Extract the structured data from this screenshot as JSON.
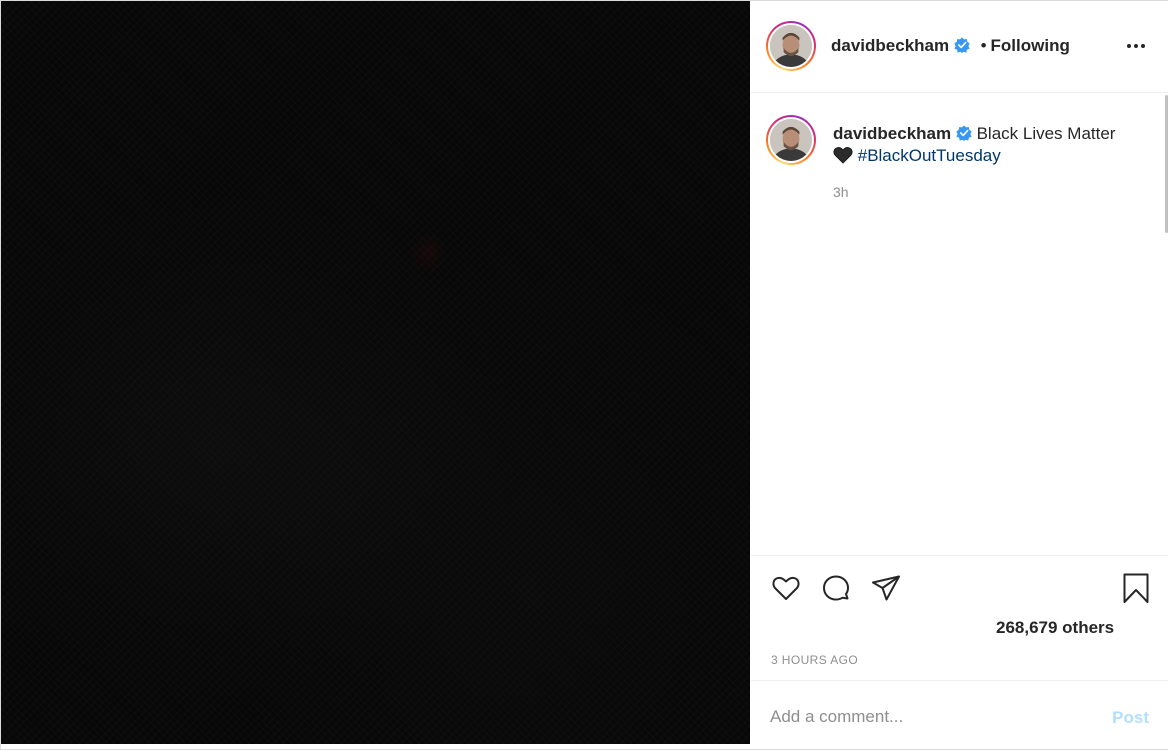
{
  "post": {
    "username": "davidbeckham",
    "follow_status": "Following",
    "separator": "•",
    "caption": {
      "username": "davidbeckham",
      "text": "Black Lives Matter",
      "emoji": "black-heart",
      "hashtag": "#BlackOutTuesday",
      "time_short": "3h"
    },
    "likes_text": "268,679 others",
    "timestamp": "3 HOURS AGO"
  },
  "comment": {
    "placeholder": "Add a comment...",
    "post_label": "Post"
  },
  "icons": {
    "more": "more-options-icon",
    "like": "heart-icon",
    "comment": "comment-icon",
    "share": "share-icon",
    "save": "bookmark-icon",
    "verified": "verified-badge-icon"
  },
  "colors": {
    "verified": "#3897f0",
    "hashtag": "#00376b",
    "post_button_disabled": "#b2dffc",
    "secondary_text": "#8e8e8e"
  }
}
